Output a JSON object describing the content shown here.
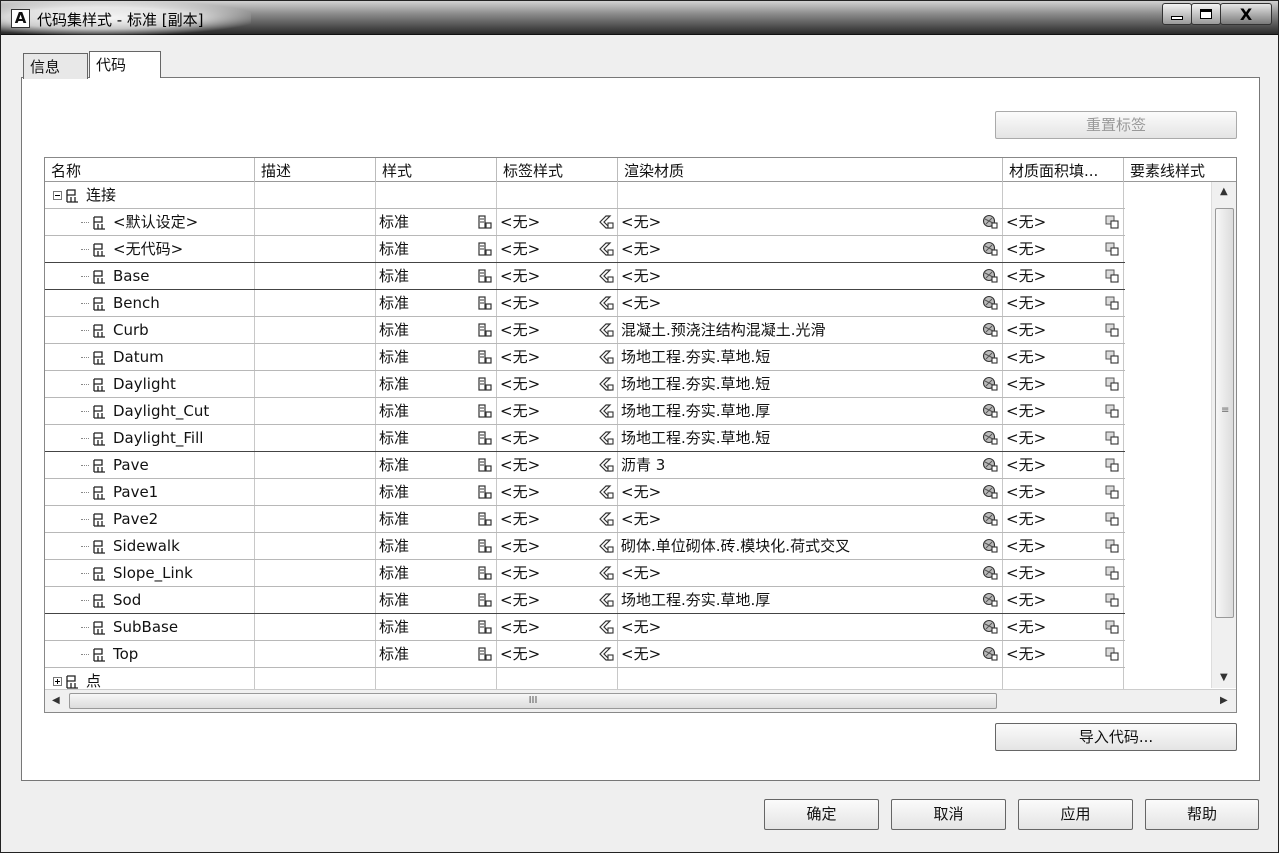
{
  "window": {
    "title": "代码集样式 - 标准 [副本]",
    "app_icon_letter": "A",
    "close_glyph": "X"
  },
  "tabs": [
    {
      "label": "信息"
    },
    {
      "label": "代码"
    }
  ],
  "buttons": {
    "reset_labels": "重置标签",
    "import_codes": "导入代码...",
    "ok": "确定",
    "cancel": "取消",
    "apply": "应用",
    "help": "帮助"
  },
  "columns": [
    "名称",
    "描述",
    "样式",
    "标签样式",
    "渲染材质",
    "材质面积填...",
    "要素线样式"
  ],
  "groups": {
    "link": "连接",
    "point": "点"
  },
  "rows": [
    {
      "name": "<默认设定>",
      "style": "标准",
      "label": "<无>",
      "material": "<无>",
      "area": "<无>"
    },
    {
      "name": "<无代码>",
      "style": "标准",
      "label": "<无>",
      "material": "<无>",
      "area": "<无>"
    },
    {
      "name": "Base",
      "style": "标准",
      "label": "<无>",
      "material": "<无>",
      "area": "<无>"
    },
    {
      "name": "Bench",
      "style": "标准",
      "label": "<无>",
      "material": "<无>",
      "area": "<无>"
    },
    {
      "name": "Curb",
      "style": "标准",
      "label": "<无>",
      "material": "混凝土.预浇注结构混凝土.光滑",
      "area": "<无>"
    },
    {
      "name": "Datum",
      "style": "标准",
      "label": "<无>",
      "material": "场地工程.夯实.草地.短",
      "area": "<无>"
    },
    {
      "name": "Daylight",
      "style": "标准",
      "label": "<无>",
      "material": "场地工程.夯实.草地.短",
      "area": "<无>"
    },
    {
      "name": "Daylight_Cut",
      "style": "标准",
      "label": "<无>",
      "material": "场地工程.夯实.草地.厚",
      "area": "<无>"
    },
    {
      "name": "Daylight_Fill",
      "style": "标准",
      "label": "<无>",
      "material": "场地工程.夯实.草地.短",
      "area": "<无>"
    },
    {
      "name": "Pave",
      "style": "标准",
      "label": "<无>",
      "material": "沥青 3",
      "area": "<无>"
    },
    {
      "name": "Pave1",
      "style": "标准",
      "label": "<无>",
      "material": "<无>",
      "area": "<无>"
    },
    {
      "name": "Pave2",
      "style": "标准",
      "label": "<无>",
      "material": "<无>",
      "area": "<无>"
    },
    {
      "name": "Sidewalk",
      "style": "标准",
      "label": "<无>",
      "material": "砌体.单位砌体.砖.模块化.荷式交叉",
      "area": "<无>"
    },
    {
      "name": "Slope_Link",
      "style": "标准",
      "label": "<无>",
      "material": "<无>",
      "area": "<无>"
    },
    {
      "name": "Sod",
      "style": "标准",
      "label": "<无>",
      "material": "场地工程.夯实.草地.厚",
      "area": "<无>"
    },
    {
      "name": "SubBase",
      "style": "标准",
      "label": "<无>",
      "material": "<无>",
      "area": "<无>"
    },
    {
      "name": "Top",
      "style": "标准",
      "label": "<无>",
      "material": "<无>",
      "area": "<无>"
    }
  ],
  "scrollbar": {
    "h_thumb_grip": "III"
  }
}
